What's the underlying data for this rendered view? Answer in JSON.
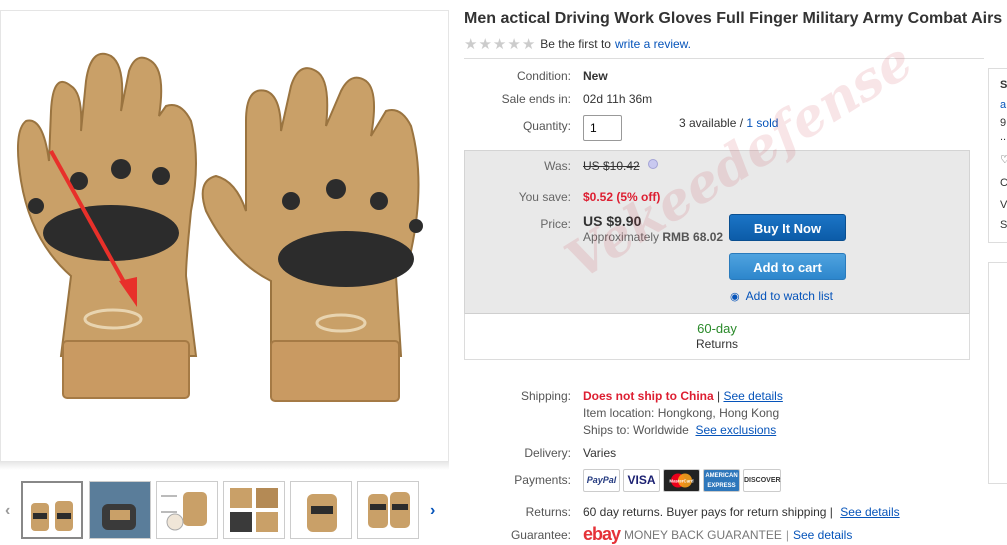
{
  "title": "Men actical Driving Work Gloves Full Finger Military Army Combat Airs",
  "rating": {
    "text": "Be the first to",
    "link": "write a review."
  },
  "condition": {
    "label": "Condition:",
    "value": "New"
  },
  "sale_ends": {
    "label": "Sale ends in:",
    "value": "02d 11h 36m"
  },
  "quantity": {
    "label": "Quantity:",
    "value": "1",
    "available": "3 available",
    "sep": " / ",
    "sold": "1 sold"
  },
  "was": {
    "label": "Was:",
    "value": "US $10.42"
  },
  "you_save": {
    "label": "You save:",
    "value": "$0.52 (5% off)"
  },
  "price": {
    "label": "Price:",
    "value": "US $9.90",
    "approx_prefix": "Approximately",
    "approx_value": "RMB 68.02"
  },
  "buttons": {
    "buy": "Buy It Now",
    "cart": "Add to cart",
    "watch": "Add to watch list"
  },
  "returns_box": {
    "days": "60-day",
    "label": "Returns"
  },
  "shipping": {
    "label": "Shipping:",
    "warning": "Does not ship to China",
    "sep": " | ",
    "see_details": "See details",
    "location": "Item location:  Hongkong, Hong Kong",
    "ships_to": "Ships to:  Worldwide",
    "see_exclusions": "See exclusions"
  },
  "delivery": {
    "label": "Delivery:",
    "value": "Varies"
  },
  "payments": {
    "label": "Payments:",
    "logos": [
      "PayPal",
      "VISA",
      "MasterCard",
      "AMERICAN EXPRESS",
      "DISCOVER"
    ]
  },
  "returns": {
    "label": "Returns:",
    "value": "60 day returns. Buyer pays for return shipping |",
    "link": "See details"
  },
  "guarantee": {
    "label": "Guarantee:",
    "brand": "ebay",
    "text": "MONEY BACK GUARANTEE",
    "sep": "|",
    "link": "See details"
  },
  "watermark": "Vekeedefense",
  "right_panel": [
    "S",
    "a",
    "9",
    "..",
    "♡",
    "C",
    "V",
    "S"
  ],
  "colors": {
    "link": "#0654ba",
    "save_red": "#dd1e31",
    "returns_green": "#2a8a2a",
    "buy_blue": "#0c5ca8"
  },
  "thumbnail_count": 6
}
